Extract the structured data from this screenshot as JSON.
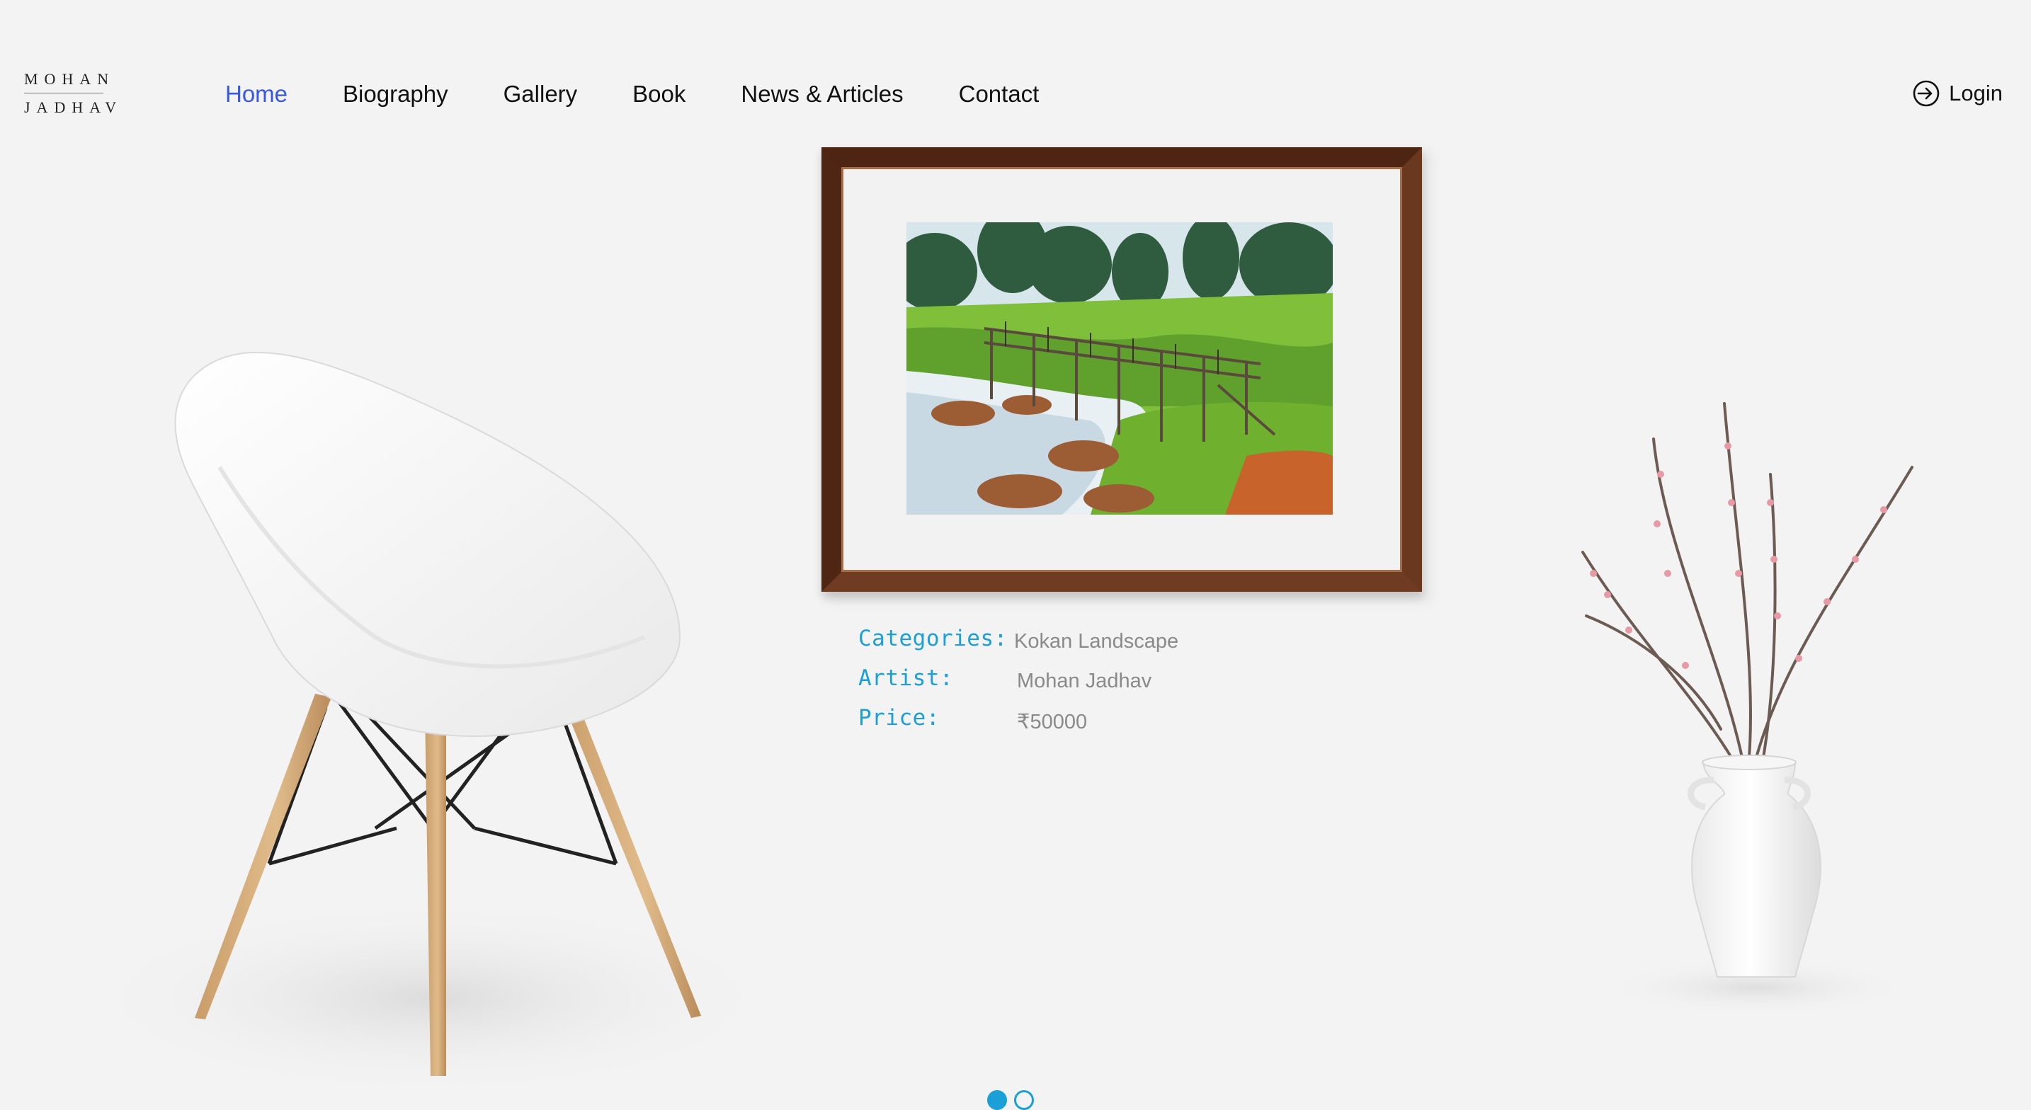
{
  "logo": {
    "line1": "MOHAN",
    "line2": "JADHAV"
  },
  "nav": {
    "items": [
      {
        "label": "Home",
        "active": true
      },
      {
        "label": "Biography",
        "active": false
      },
      {
        "label": "Gallery",
        "active": false
      },
      {
        "label": "Book",
        "active": false
      },
      {
        "label": "News & Articles",
        "active": false
      },
      {
        "label": "Contact",
        "active": false
      }
    ]
  },
  "login": {
    "label": "Login",
    "icon": "login-icon"
  },
  "artwork": {
    "details": [
      {
        "key": "Categories:",
        "value": "Kokan Landscape"
      },
      {
        "key": "Artist:",
        "value": "Mohan Jadhav"
      },
      {
        "key": "Price:",
        "value": "₹50000"
      }
    ]
  },
  "carousel": {
    "total": 2,
    "active_index": 0
  },
  "colors": {
    "accent_nav": "#3757e6",
    "detail_key": "#1aa0d6",
    "detail_value": "#8a8a8a",
    "frame": "#5b2d19",
    "background": "#f3f3f3"
  }
}
